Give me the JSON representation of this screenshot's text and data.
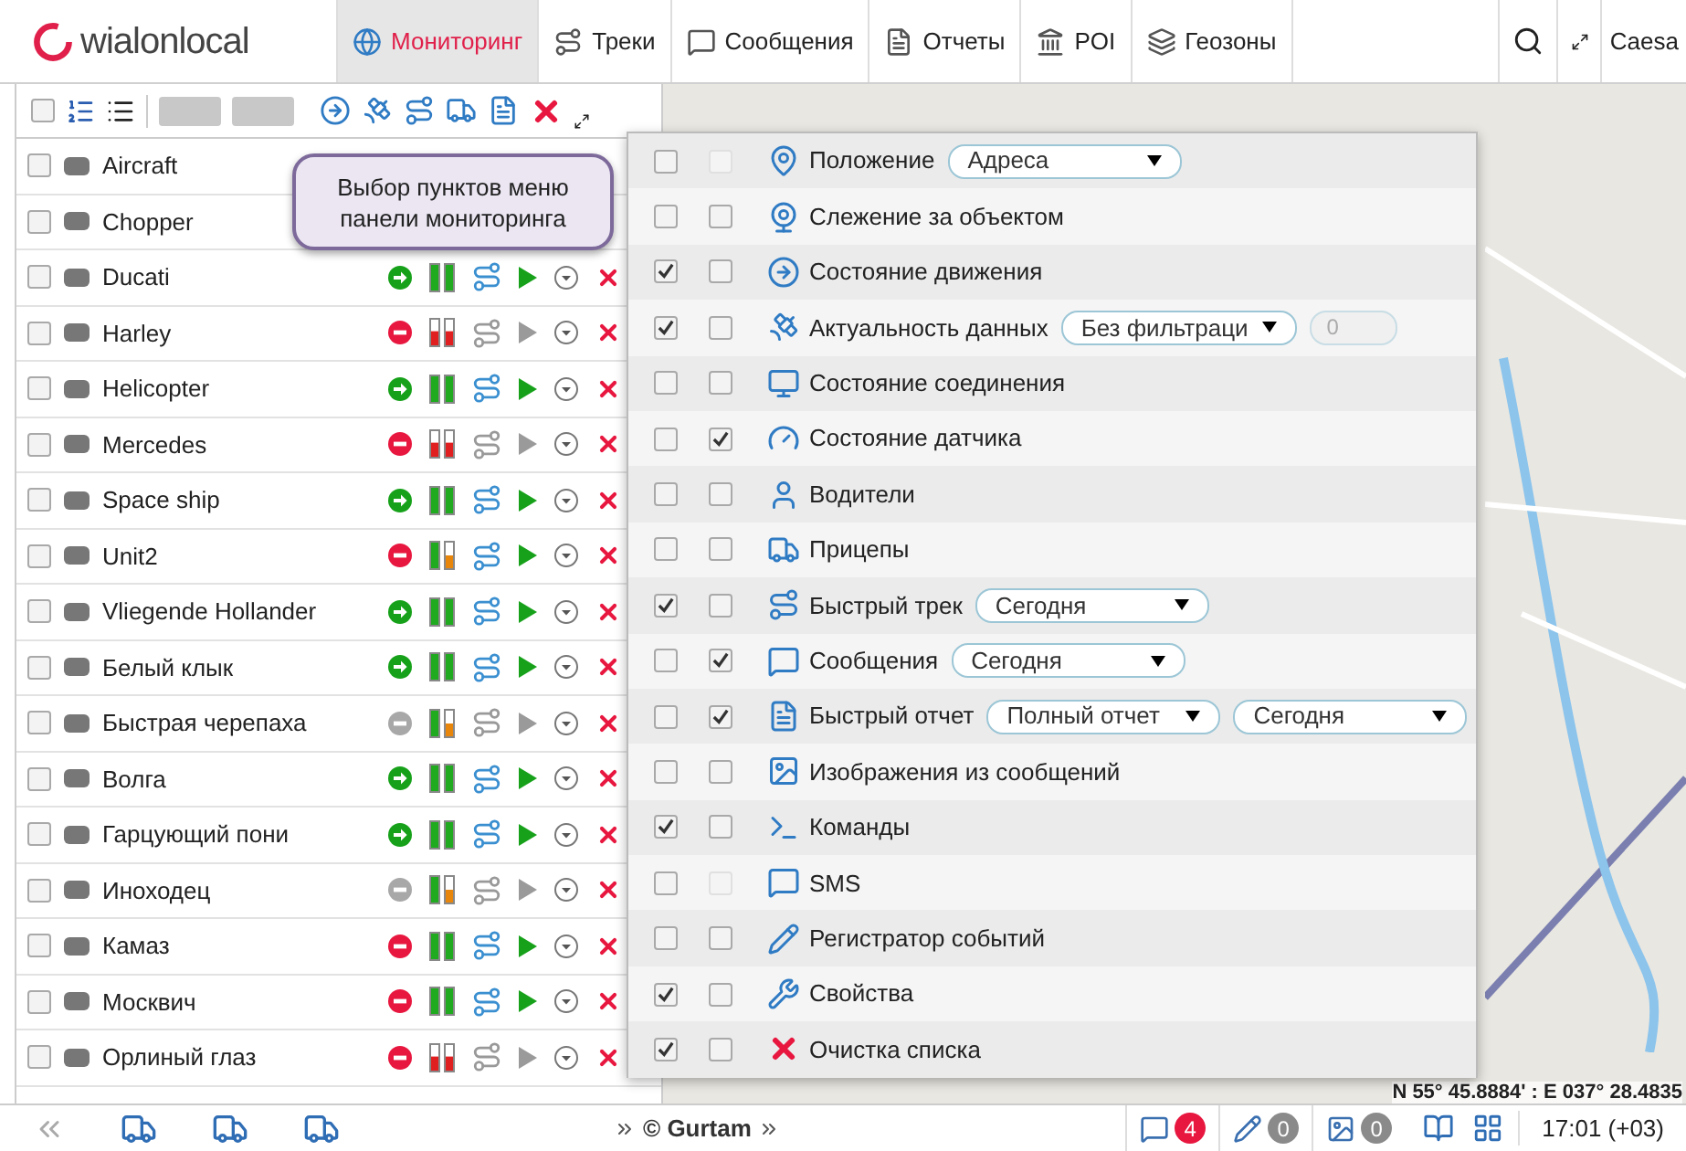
{
  "header": {
    "logo": "wialonlocal",
    "tabs": [
      {
        "label": "Мониторинг",
        "selected": true
      },
      {
        "label": "Треки",
        "selected": false
      },
      {
        "label": "Сообщения",
        "selected": false
      },
      {
        "label": "Отчеты",
        "selected": false
      },
      {
        "label": "POI",
        "selected": false
      },
      {
        "label": "Геозоны",
        "selected": false
      }
    ],
    "user": "Caesa"
  },
  "toolbar": {
    "select_all": false
  },
  "units": [
    {
      "name": "Aircraft",
      "selected": false
    },
    {
      "name": "Chopper",
      "selected": false
    },
    {
      "name": "Ducati",
      "selected": false,
      "online": true,
      "moving": true,
      "color": "#1faa1f",
      "active": true
    },
    {
      "name": "Harley",
      "selected": false,
      "online": true,
      "moving": false,
      "color": "#e02020",
      "active": false
    },
    {
      "name": "Helicopter",
      "selected": false,
      "online": true,
      "moving": true,
      "color": "#1faa1f",
      "active": true
    },
    {
      "name": "Mercedes",
      "selected": false,
      "online": true,
      "moving": false,
      "color": "#e02020",
      "active": false
    },
    {
      "name": "Space ship",
      "selected": false,
      "online": true,
      "moving": true,
      "color": "#1faa1f",
      "active": true
    },
    {
      "name": "Unit2",
      "selected": false,
      "online": true,
      "moving": false,
      "color": "#e8860c",
      "active": true
    },
    {
      "name": "Vliegende Hollander",
      "selected": false,
      "online": true,
      "moving": true,
      "color": "#1faa1f",
      "active": true
    },
    {
      "name": "Белый клык",
      "selected": false,
      "online": true,
      "moving": true,
      "color": "#1faa1f",
      "active": true
    },
    {
      "name": "Быстрая черепаха",
      "selected": false,
      "online": false,
      "color": "#e8860c",
      "active": false
    },
    {
      "name": "Волга",
      "selected": false,
      "online": true,
      "moving": true,
      "color": "#1faa1f",
      "active": true
    },
    {
      "name": "Гарцующий пони",
      "selected": false,
      "online": true,
      "moving": true,
      "color": "#1faa1f",
      "active": true
    },
    {
      "name": "Иноходец",
      "selected": false,
      "online": false,
      "color": "#e8860c",
      "active": false
    },
    {
      "name": "Камаз",
      "selected": false,
      "online": true,
      "moving": false,
      "color": "#1faa1f",
      "active": true
    },
    {
      "name": "Москвич",
      "selected": false,
      "online": true,
      "moving": false,
      "color": "#1faa1f",
      "active": true
    },
    {
      "name": "Орлиный глаз",
      "selected": false,
      "online": true,
      "moving": false,
      "color": "#e02020",
      "active": false
    }
  ],
  "tooltip": "Выбор пунктов меню панели мониторинга",
  "menu": [
    {
      "label": "Положение",
      "checked": false,
      "checked_2": false,
      "disabled_2": true,
      "dropdowns": [
        "Адреса"
      ]
    },
    {
      "label": "Слежение за объектом",
      "checked": false,
      "checked_2": false,
      "disabled_2": false
    },
    {
      "label": "Состояние движения",
      "checked": true,
      "checked_2": false,
      "disabled_2": false
    },
    {
      "label": "Актуальность данных",
      "checked": true,
      "checked_2": false,
      "disabled_2": false,
      "dropdowns": [
        "Без фильтраци"
      ],
      "field": "0"
    },
    {
      "label": "Состояние соединения",
      "checked": false,
      "checked_2": false,
      "disabled_2": false
    },
    {
      "label": "Состояние датчика",
      "checked": false,
      "checked_2": true,
      "disabled_2": false
    },
    {
      "label": "Водители",
      "checked": false,
      "checked_2": false,
      "disabled_2": false
    },
    {
      "label": "Прицепы",
      "checked": false,
      "checked_2": false,
      "disabled_2": false
    },
    {
      "label": "Быстрый трек",
      "checked": true,
      "checked_2": false,
      "disabled_2": false,
      "dropdowns": [
        "Сегодня"
      ]
    },
    {
      "label": "Сообщения",
      "checked": false,
      "checked_2": true,
      "disabled_2": false,
      "dropdowns": [
        "Сегодня"
      ]
    },
    {
      "label": "Быстрый отчет",
      "checked": false,
      "checked_2": true,
      "disabled_2": false,
      "dropdowns": [
        "Полный отчет",
        "Сегодня"
      ]
    },
    {
      "label": "Изображения из сообщений",
      "checked": false,
      "checked_2": false,
      "disabled_2": false
    },
    {
      "label": "Команды",
      "checked": true,
      "checked_2": false,
      "disabled_2": false
    },
    {
      "label": "SMS",
      "checked": false,
      "checked_2": false,
      "disabled_2": true
    },
    {
      "label": "Регистратор событий",
      "checked": false,
      "checked_2": false,
      "disabled_2": false
    },
    {
      "label": "Свойства",
      "checked": true,
      "checked_2": false,
      "disabled_2": false
    },
    {
      "label": "Очистка списка",
      "checked": true,
      "checked_2": false,
      "disabled_2": false
    }
  ],
  "map": {
    "coordinates": "N 55° 45.8884' : E 037° 28.4835"
  },
  "status_bar": {
    "copyright": "© Gurtam",
    "badges": [
      {
        "count": "4",
        "color": "#e8173f"
      },
      {
        "count": "0",
        "color": "#8a8a8a"
      },
      {
        "count": "0",
        "color": "#8a8a8a"
      }
    ],
    "time": "17:01 (+03)"
  }
}
